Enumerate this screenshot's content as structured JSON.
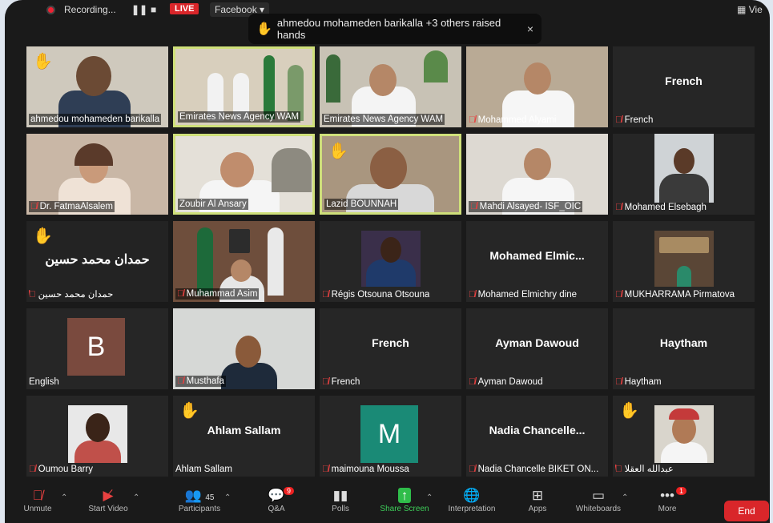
{
  "topbar": {
    "recording_label": "Recording...",
    "live_label": "LIVE",
    "facebook_label": "Facebook",
    "view_label": "Vie"
  },
  "banner": {
    "text": "ahmedou mohameden barikalla +3 others raised hands",
    "close": "×"
  },
  "tiles": [
    {
      "name": "ahmedou mohameden barikalla"
    },
    {
      "name": "Emirates News Agency WAM"
    },
    {
      "name": "Emirates News Agency WAM"
    },
    {
      "name": "Mohammed Alyami"
    },
    {
      "name": "French",
      "center": "French"
    },
    {
      "name": "Dr. FatmaAlsalem"
    },
    {
      "name": "Zoubir Al Ansary"
    },
    {
      "name": "Lazid BOUNNAH"
    },
    {
      "name": "Mahdi Alsayed- ISF_OIC"
    },
    {
      "name": "Mohamed Elsebagh"
    },
    {
      "name": "حمدان محمد حسين",
      "center": "حمدان محمد حسين"
    },
    {
      "name": "Muhammad Asim"
    },
    {
      "name": "Régis Otsouna Otsouna"
    },
    {
      "name": "Mohamed Elmichry dine",
      "center": "Mohamed Elmic..."
    },
    {
      "name": "MUKHARRAMA Pirmatova"
    },
    {
      "name": "English",
      "avatar": "B"
    },
    {
      "name": "Musthafa"
    },
    {
      "name": "French",
      "center": "French"
    },
    {
      "name": "Ayman Dawoud",
      "center": "Ayman Dawoud"
    },
    {
      "name": "Haytham",
      "center": "Haytham"
    },
    {
      "name": "Oumou Barry"
    },
    {
      "name": "Ahlam Sallam",
      "center": "Ahlam Sallam"
    },
    {
      "name": "maimouna Moussa",
      "avatar": "M"
    },
    {
      "name": "Nadia Chancelle BIKET ON...",
      "center": "Nadia Chancelle..."
    },
    {
      "name": "عبدالله العقلا"
    }
  ],
  "toolbar": {
    "unmute": "Unmute",
    "start_video": "Start Video",
    "participants": "Participants",
    "participants_count": "45",
    "qa": "Q&A",
    "qa_badge": "9",
    "polls": "Polls",
    "share_screen": "Share Screen",
    "interpretation": "Interpretation",
    "apps": "Apps",
    "whiteboards": "Whiteboards",
    "more": "More",
    "more_badge": "1",
    "end": "End"
  },
  "colors": {
    "live_red": "#d9262a",
    "share_green": "#2fbd4a",
    "raised_hand": "#f5c542",
    "active_border": "#cfe07a",
    "avatar_b": "#7a4a3e",
    "avatar_m": "#1a8a76"
  }
}
